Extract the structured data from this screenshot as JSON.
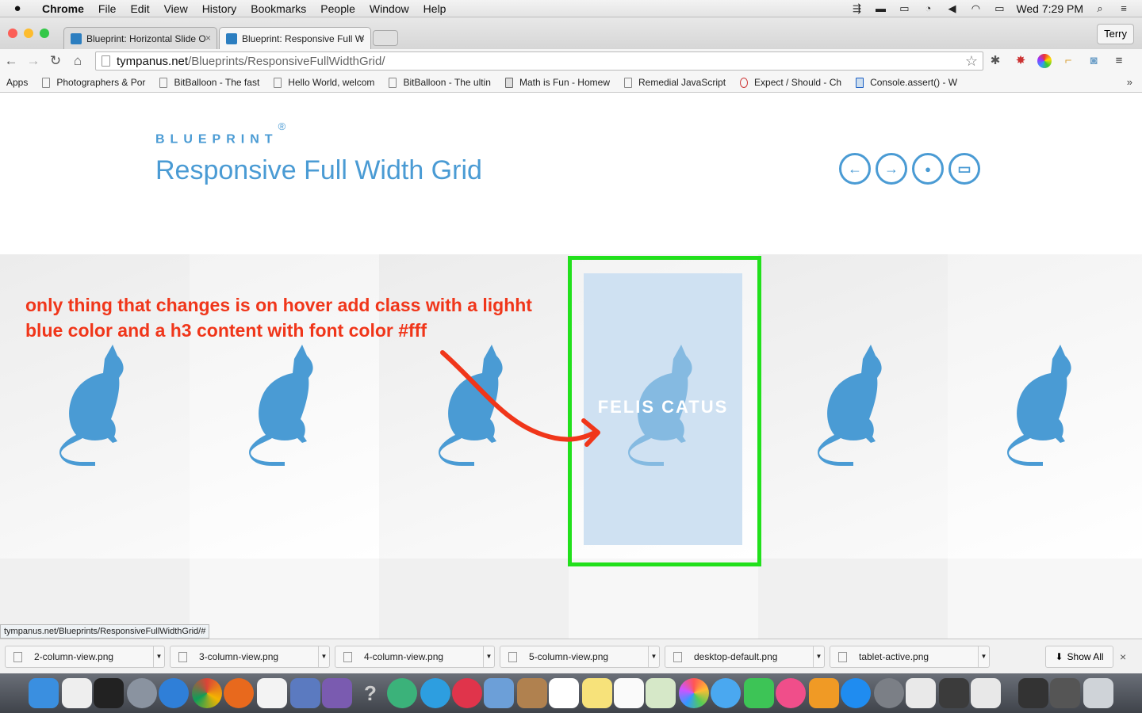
{
  "menubar": {
    "apple": "",
    "items": [
      "Chrome",
      "File",
      "Edit",
      "View",
      "History",
      "Bookmarks",
      "People",
      "Window",
      "Help"
    ],
    "clock": "Wed 7:29 PM"
  },
  "tabs": [
    {
      "title": "Blueprint: Horizontal Slide O",
      "close": "×"
    },
    {
      "title": "Blueprint: Responsive Full W",
      "close": "×"
    }
  ],
  "profile": "Terry",
  "toolbar": {
    "back": "←",
    "forward": "→",
    "reload": "↻",
    "home": "⌂",
    "url_host": "tympanus.net",
    "url_path": "/Blueprints/ResponsiveFullWidthGrid/",
    "star": "☆",
    "menu": "≡"
  },
  "bookmarks": [
    {
      "label": "Apps",
      "icon": "apps-grid-icon"
    },
    {
      "label": "Photographers & Por",
      "icon": "page-icon"
    },
    {
      "label": "BitBalloon - The fast",
      "icon": "page-icon"
    },
    {
      "label": "Hello World, welcom",
      "icon": "page-icon"
    },
    {
      "label": "BitBalloon - The ultin",
      "icon": "page-icon"
    },
    {
      "label": "Math is Fun - Homew",
      "icon": "math-icon"
    },
    {
      "label": "Remedial JavaScript",
      "icon": "page-icon"
    },
    {
      "label": "Expect / Should - Ch",
      "icon": "c-icon"
    },
    {
      "label": "Console.assert() - W",
      "icon": "mdn-icon"
    }
  ],
  "bookmarks_more": "»",
  "page": {
    "brand": "BLUEPRINT",
    "brand_mark": "®",
    "title": "Responsive Full Width Grid",
    "nav_buttons": [
      {
        "name": "previous-blueprint-button",
        "glyph": "←"
      },
      {
        "name": "next-blueprint-button",
        "glyph": "→"
      },
      {
        "name": "drop-icon-button",
        "glyph": "●"
      },
      {
        "name": "archive-button",
        "glyph": "▭"
      }
    ],
    "hover_caption": "FELIS CATUS",
    "annotation": "only thing that changes is on hover add class with a lighht blue color and a h3 content with font color #fff",
    "hover_color": "#cfe1f2",
    "accent": "#4a9bd4",
    "annotation_color": "#f0361a",
    "highlight_color": "#22e01c"
  },
  "status_url": "tympanus.net/Blueprints/ResponsiveFullWidthGrid/#",
  "downloads": [
    "2-column-view.png",
    "3-column-view.png",
    "4-column-view.png",
    "5-column-view.png",
    "desktop-default.png",
    "tablet-active.png"
  ],
  "show_all": "Show All",
  "shelf_close": "×"
}
